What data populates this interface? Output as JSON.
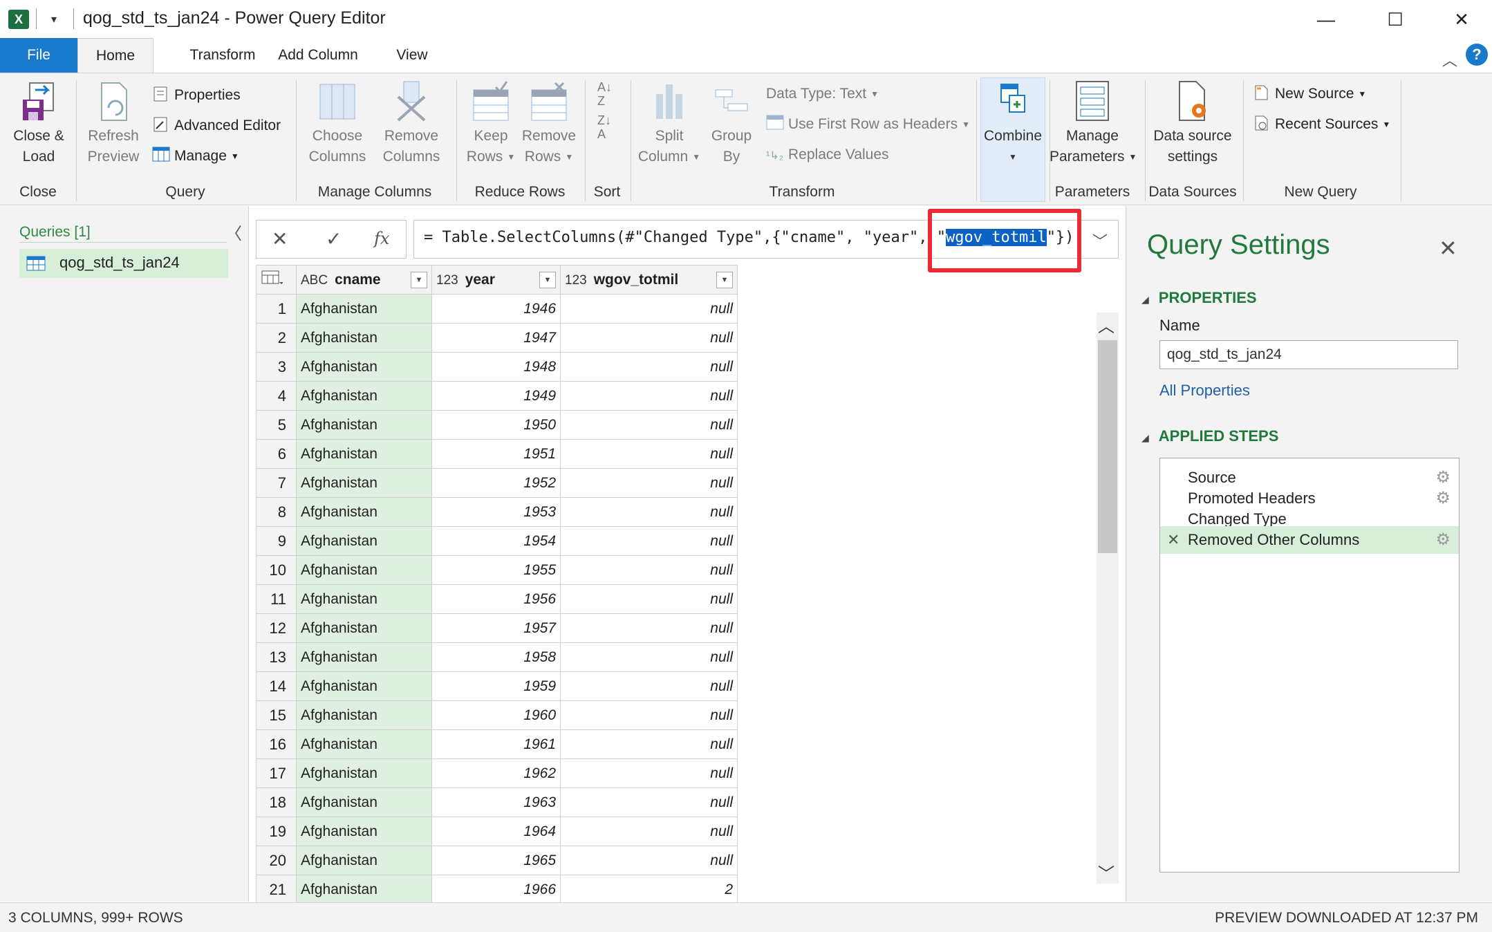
{
  "window": {
    "title": "qog_std_ts_jan24 - Power Query Editor",
    "app_icon": "excel-icon",
    "minimize": "—",
    "maximize": "☐",
    "close": "✕"
  },
  "tabs": [
    "File",
    "Home",
    "Transform",
    "Add Column",
    "View"
  ],
  "ribbon": {
    "close_load": "Close &\nLoad",
    "close_group": "Close",
    "refresh_preview": "Refresh\nPreview",
    "properties": "Properties",
    "advanced_editor": "Advanced Editor",
    "manage": "Manage",
    "query_group": "Query",
    "choose_columns": "Choose\nColumns",
    "remove_columns": "Remove\nColumns",
    "manage_columns_group": "Manage Columns",
    "keep_rows": "Keep\nRows",
    "remove_rows": "Remove\nRows",
    "reduce_rows_group": "Reduce Rows",
    "sort_group": "Sort",
    "split_column": "Split\nColumn",
    "group_by": "Group\nBy",
    "data_type": "Data Type: Text",
    "use_first_row": "Use First Row as Headers",
    "replace_values": "Replace Values",
    "transform_group": "Transform",
    "combine": "Combine",
    "manage_parameters": "Manage\nParameters",
    "parameters_group": "Parameters",
    "data_source_settings": "Data source\nsettings",
    "data_sources_group": "Data Sources",
    "new_source": "New Source",
    "recent_sources": "Recent Sources",
    "new_query_group": "New Query"
  },
  "queries": {
    "title": "Queries [1]",
    "items": [
      "qog_std_ts_jan24"
    ]
  },
  "formula": {
    "prefix": "= Table.SelectColumns(#\"Changed Type\",{\"cname\", \"year\", \"",
    "selected": "wgov_totmil",
    "suffix": "\"})"
  },
  "grid": {
    "columns": [
      {
        "type_icon": "ABC",
        "name": "cname"
      },
      {
        "type_icon": "123",
        "name": "year"
      },
      {
        "type_icon": "123",
        "name": "wgov_totmil"
      }
    ],
    "rows": [
      [
        "1",
        "Afghanistan",
        "1946",
        "null"
      ],
      [
        "2",
        "Afghanistan",
        "1947",
        "null"
      ],
      [
        "3",
        "Afghanistan",
        "1948",
        "null"
      ],
      [
        "4",
        "Afghanistan",
        "1949",
        "null"
      ],
      [
        "5",
        "Afghanistan",
        "1950",
        "null"
      ],
      [
        "6",
        "Afghanistan",
        "1951",
        "null"
      ],
      [
        "7",
        "Afghanistan",
        "1952",
        "null"
      ],
      [
        "8",
        "Afghanistan",
        "1953",
        "null"
      ],
      [
        "9",
        "Afghanistan",
        "1954",
        "null"
      ],
      [
        "10",
        "Afghanistan",
        "1955",
        "null"
      ],
      [
        "11",
        "Afghanistan",
        "1956",
        "null"
      ],
      [
        "12",
        "Afghanistan",
        "1957",
        "null"
      ],
      [
        "13",
        "Afghanistan",
        "1958",
        "null"
      ],
      [
        "14",
        "Afghanistan",
        "1959",
        "null"
      ],
      [
        "15",
        "Afghanistan",
        "1960",
        "null"
      ],
      [
        "16",
        "Afghanistan",
        "1961",
        "null"
      ],
      [
        "17",
        "Afghanistan",
        "1962",
        "null"
      ],
      [
        "18",
        "Afghanistan",
        "1963",
        "null"
      ],
      [
        "19",
        "Afghanistan",
        "1964",
        "null"
      ],
      [
        "20",
        "Afghanistan",
        "1965",
        "null"
      ],
      [
        "21",
        "Afghanistan",
        "1966",
        "2"
      ]
    ]
  },
  "settings": {
    "title": "Query Settings",
    "properties_head": "PROPERTIES",
    "name_label": "Name",
    "name_value": "qog_std_ts_jan24",
    "all_properties": "All Properties",
    "applied_steps_head": "APPLIED STEPS",
    "steps": [
      {
        "label": "Source",
        "gear": true,
        "selected": false
      },
      {
        "label": "Promoted Headers",
        "gear": true,
        "selected": false
      },
      {
        "label": "Changed Type",
        "gear": false,
        "selected": false
      },
      {
        "label": "Removed Other Columns",
        "gear": true,
        "selected": true
      }
    ]
  },
  "status": {
    "left": "3 COLUMNS, 999+ ROWS",
    "right": "PREVIEW DOWNLOADED AT 12:37 PM"
  },
  "colors": {
    "accent": "#1979ca",
    "green_text": "#1f7a3c",
    "highlight_red": "#ec2a35",
    "selection": "#d7eed9"
  }
}
